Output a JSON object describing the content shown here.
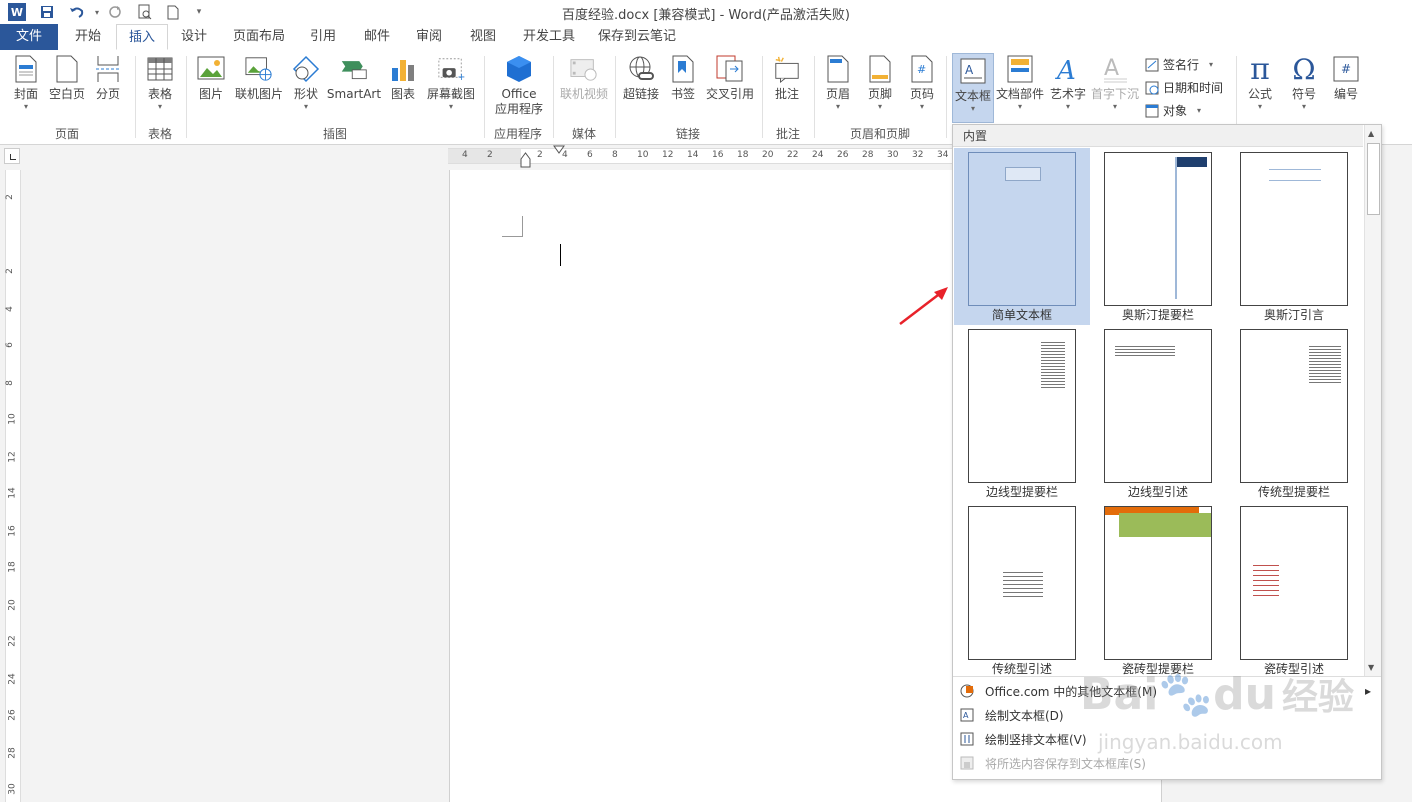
{
  "window": {
    "title": "百度经验.docx [兼容模式] - Word(产品激活失败)"
  },
  "quick_access": {
    "save_icon": "save-icon",
    "undo_icon": "undo-icon",
    "redo_icon": "redo-icon"
  },
  "tabs": [
    "文件",
    "开始",
    "插入",
    "设计",
    "页面布局",
    "引用",
    "邮件",
    "审阅",
    "视图",
    "开发工具",
    "保存到云笔记"
  ],
  "active_tab": "插入",
  "ribbon": {
    "pages": {
      "cover": "封面",
      "blank": "空白页",
      "break": "分页",
      "group": "页面"
    },
    "tables": {
      "table": "表格",
      "group": "表格"
    },
    "illustrations": {
      "picture": "图片",
      "online_picture": "联机图片",
      "shapes": "形状",
      "smartart": "SmartArt",
      "chart": "图表",
      "screenshot": "屏幕截图",
      "group": "插图"
    },
    "apps": {
      "office_line1": "Office",
      "office_line2": "应用程序",
      "group": "应用程序"
    },
    "media": {
      "online_video": "联机视频",
      "group": "媒体"
    },
    "links": {
      "hyperlink": "超链接",
      "bookmark": "书签",
      "cross_ref": "交叉引用",
      "group": "链接"
    },
    "comments": {
      "comment": "批注",
      "group": "批注"
    },
    "header_footer": {
      "header": "页眉",
      "footer": "页脚",
      "page_number": "页码",
      "group": "页眉和页脚"
    },
    "text": {
      "textbox": "文本框",
      "quick_parts": "文档部件",
      "wordart": "艺术字",
      "dropcap": "首字下沉",
      "signature": "签名行",
      "datetime": "日期和时间",
      "object": "对象"
    },
    "symbols": {
      "equation": "公式",
      "symbol": "符号",
      "number": "编号"
    }
  },
  "gallery": {
    "header": "内置",
    "items": [
      "简单文本框",
      "奥斯汀提要栏",
      "奥斯汀引言",
      "边线型提要栏",
      "边线型引述",
      "传统型提要栏",
      "传统型引述",
      "瓷砖型提要栏",
      "瓷砖型引述"
    ],
    "selected": "简单文本框",
    "menu": [
      {
        "label": "Office.com 中的其他文本框(M)",
        "icon": "office-icon",
        "enabled": true,
        "arrow": "▸"
      },
      {
        "label": "绘制文本框(D)",
        "icon": "textbox-icon",
        "enabled": true
      },
      {
        "label": "绘制竖排文本框(V)",
        "icon": "vertical-textbox-icon",
        "enabled": true
      },
      {
        "label": "将所选内容保存到文本框库(S)",
        "icon": "save-gallery-icon",
        "enabled": false
      }
    ]
  },
  "ruler": {
    "h_ticks": [
      "4",
      "2",
      "2",
      "4",
      "6",
      "8",
      "10",
      "12",
      "14",
      "16",
      "18",
      "20",
      "22",
      "24",
      "26",
      "28",
      "30",
      "32",
      "34"
    ],
    "v_ticks": [
      "2",
      "2",
      "4",
      "6",
      "8",
      "10",
      "12",
      "14",
      "16",
      "18",
      "20",
      "22",
      "24",
      "26",
      "28",
      "30"
    ]
  },
  "watermark": {
    "brand": "Bai",
    "brand2": "du",
    "cn": "经验",
    "url": "jingyan.baidu.com"
  },
  "colors": {
    "accent": "#2b579a",
    "selected": "#c5d6ee",
    "arrow": "#e8222a"
  }
}
